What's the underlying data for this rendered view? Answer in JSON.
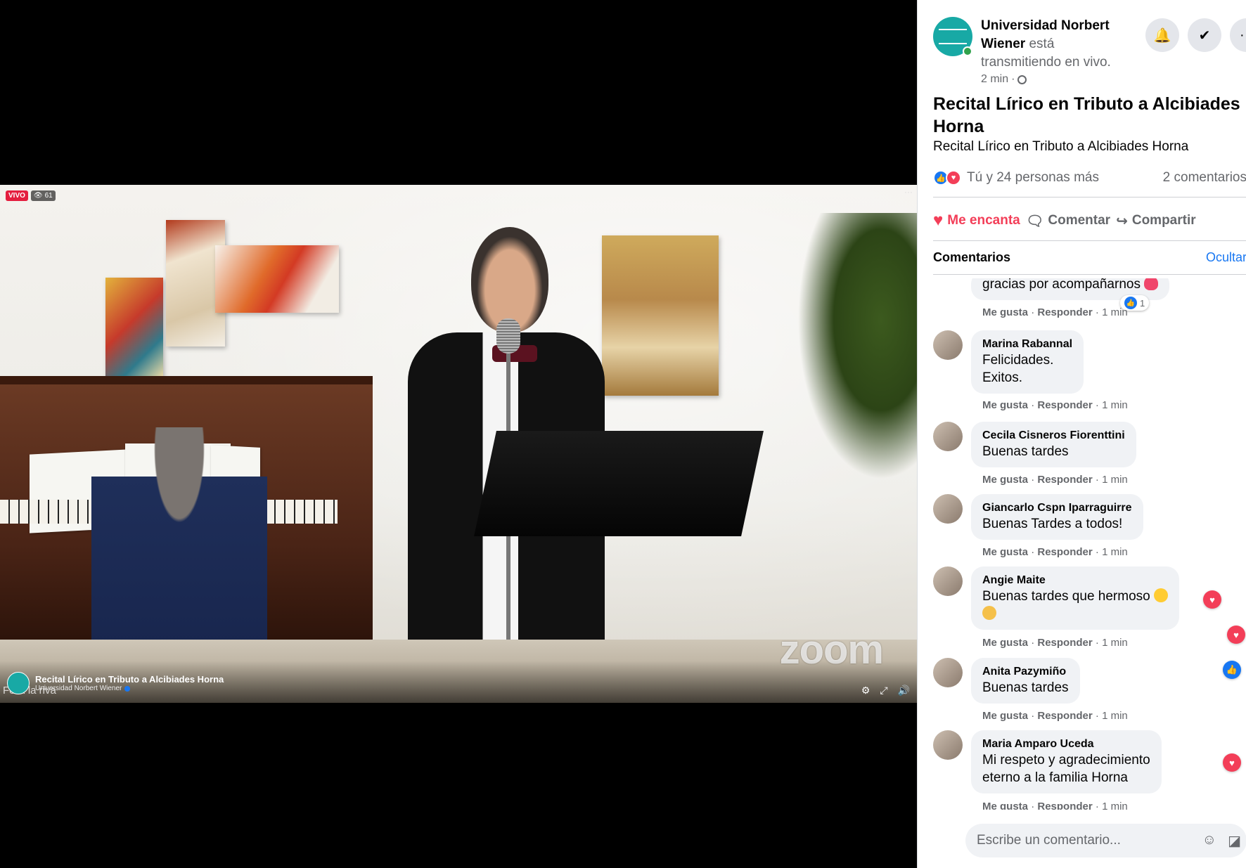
{
  "video": {
    "live_label": "VIVO",
    "viewer_count": "61",
    "watermark": "zoom",
    "overlay_title": "Recital Lírico en Tributo a Alcibiades Horna",
    "overlay_page": "Universidad Norbert Wiener",
    "overlay_participant": "Felix la riva"
  },
  "post": {
    "page_name": "Universidad Norbert Wiener",
    "live_status": "está transmitiendo en vivo.",
    "time": "2 min",
    "separator": "·",
    "title": "Recital Lírico en Tributo a Alcibiades Horna",
    "description": "Recital Lírico en Tributo a Alcibiades Horna",
    "reactions_text": "Tú y 24 personas más",
    "comment_count": "2 comentarios"
  },
  "actions": {
    "love": "Me encanta",
    "comment": "Comentar",
    "share": "Compartir"
  },
  "comments_section": {
    "label": "Comentarios",
    "hide": "Ocultar"
  },
  "comment_actions": {
    "like": "Me gusta",
    "reply": "Responder",
    "sep": "·"
  },
  "comments": [
    {
      "author": "",
      "lines": [
        "gracias por acompañarnos"
      ],
      "time": "1 min",
      "likes": "1"
    },
    {
      "author": "Marina Rabannal",
      "lines": [
        "Felicidades.",
        "Exitos."
      ],
      "time": "1 min"
    },
    {
      "author": "Cecila Cisneros Fiorenttini",
      "lines": [
        "Buenas tardes"
      ],
      "time": "1 min"
    },
    {
      "author": "Giancarlo Cspn Iparraguirre",
      "lines": [
        "Buenas Tardes a todos!"
      ],
      "time": "1 min"
    },
    {
      "author": "Angie Maite",
      "lines": [
        "Buenas tardes que hermoso"
      ],
      "time": "1 min"
    },
    {
      "author": "Anita Pazymiño",
      "lines": [
        "Buenas tardes"
      ],
      "time": "1 min"
    },
    {
      "author": "Maria Amparo Uceda",
      "lines": [
        "Mi respeto y agradecimiento",
        "eterno a la familia Horna"
      ],
      "time": "1 min"
    }
  ],
  "input": {
    "placeholder": "Escribe un comentario..."
  },
  "icons": {
    "bell": "bell-icon",
    "calendar": "calendar-check-icon",
    "more": "more-icon",
    "globe": "globe-icon",
    "emoji": "emoji-icon",
    "sticker": "sticker-icon"
  },
  "colors": {
    "facebook_blue": "#1877f2",
    "love_red": "#f33e58",
    "live_red": "#e41e3f",
    "brand_teal": "#18a9a5"
  }
}
